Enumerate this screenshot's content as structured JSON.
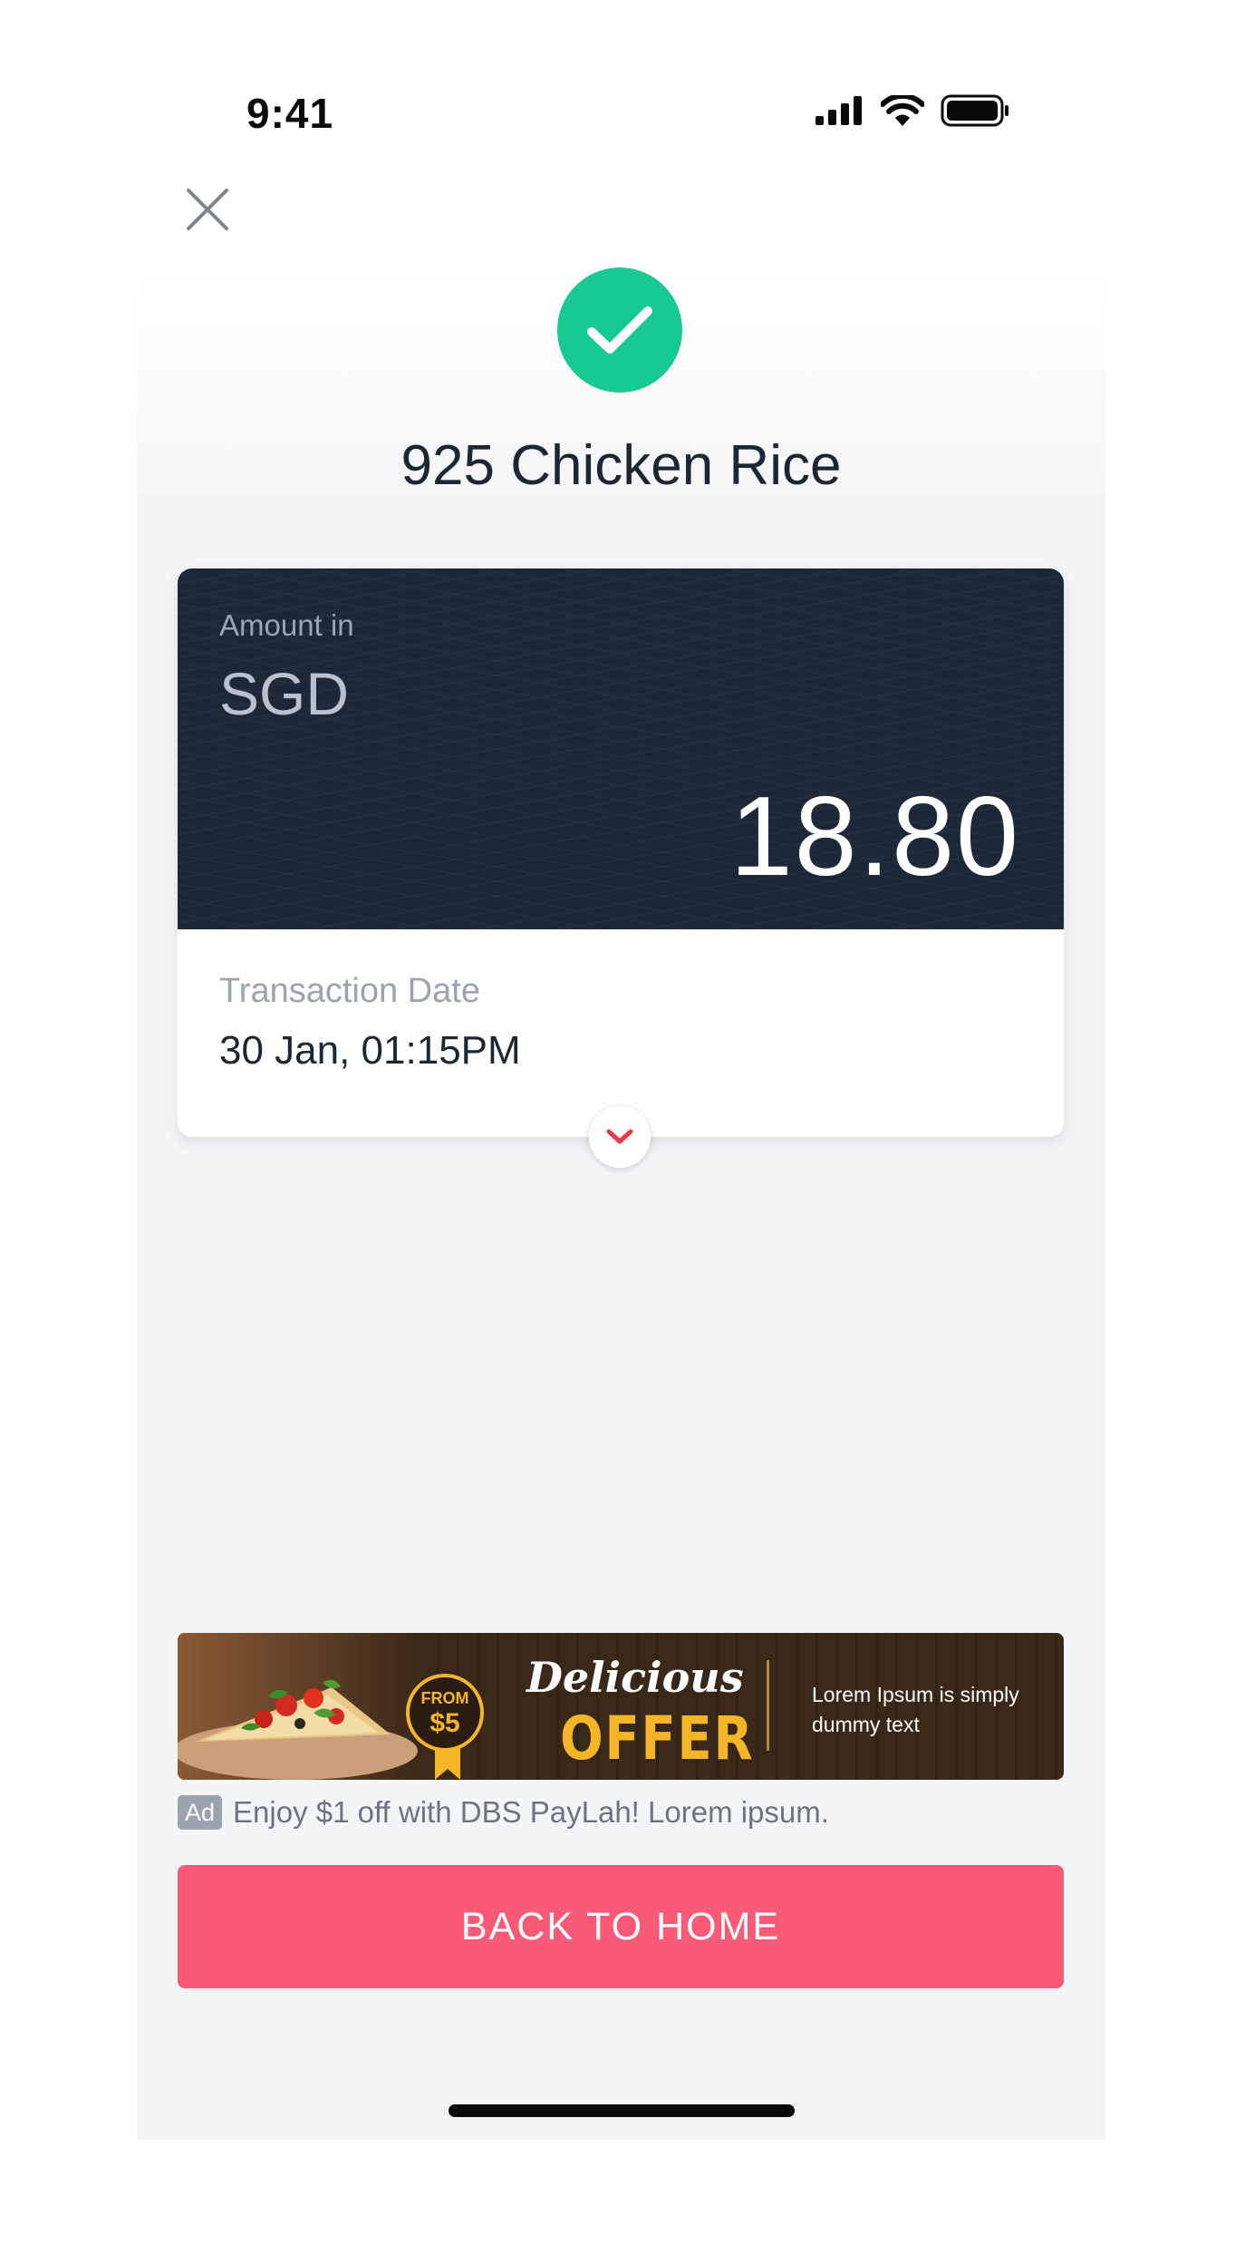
{
  "status_bar": {
    "time": "9:41",
    "icons": [
      "signal-icon",
      "wifi-icon",
      "battery-icon"
    ]
  },
  "header": {
    "close_icon": "close-icon"
  },
  "success": {
    "icon": "checkmark-icon",
    "color": "#19c992"
  },
  "merchant": {
    "name": "925 Chicken Rice"
  },
  "transaction_card": {
    "amount_label": "Amount in",
    "currency": "SGD",
    "amount": "18.80",
    "date_label": "Transaction Date",
    "date_value": "30 Jan, 01:15PM",
    "expand_icon": "chevron-down-icon"
  },
  "ad": {
    "banner": {
      "badge_top": "FROM",
      "badge_price": "$5",
      "headline": "Delicious",
      "subheadline": "OFFER",
      "description": "Lorem Ipsum is simply dummy text"
    },
    "tag": "Ad",
    "caption": "Enjoy $1 off with DBS PayLah! Lorem ipsum."
  },
  "actions": {
    "back_home_label": "BACK TO HOME"
  },
  "colors": {
    "accent": "#f95a77",
    "success": "#19c992",
    "card_dark": "#1c2837",
    "offer_gold": "#f4b526"
  }
}
